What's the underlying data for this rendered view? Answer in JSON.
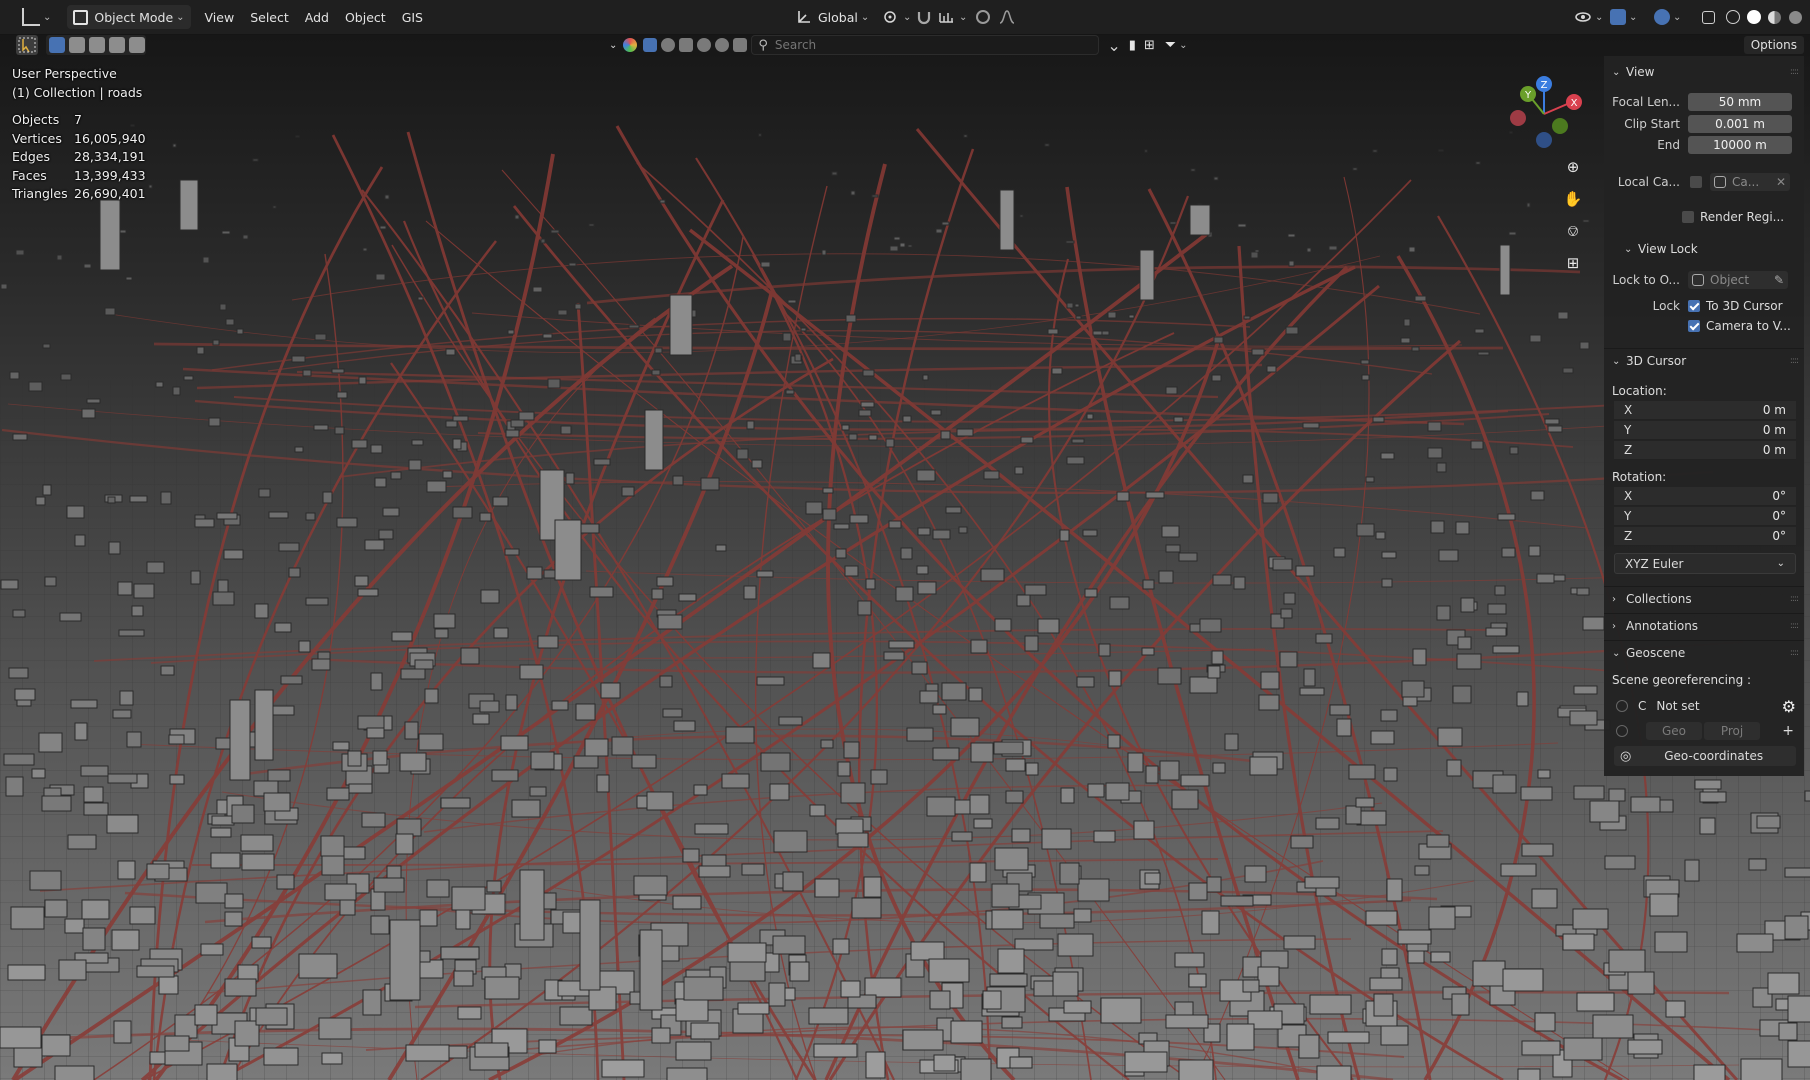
{
  "header": {
    "mode_label": "Object Mode",
    "menus": [
      "View",
      "Select",
      "Add",
      "Object",
      "GIS"
    ],
    "transform_orientation": "Global"
  },
  "toolbar": {
    "search_placeholder": "Search",
    "options_label": "Options"
  },
  "overlay": {
    "perspective": "User Perspective",
    "collection": "(1) Collection | roads",
    "stats": [
      {
        "label": "Objects",
        "value": "7"
      },
      {
        "label": "Vertices",
        "value": "16,005,940"
      },
      {
        "label": "Edges",
        "value": "28,334,191"
      },
      {
        "label": "Faces",
        "value": "13,399,433"
      },
      {
        "label": "Triangles",
        "value": "26,690,401"
      }
    ]
  },
  "gizmo": {
    "x": "X",
    "y": "Y",
    "z": "Z"
  },
  "panel": {
    "view": {
      "title": "View",
      "focal_label": "Focal Len...",
      "focal_value": "50 mm",
      "clip_start_label": "Clip Start",
      "clip_start_value": "0.001 m",
      "clip_end_label": "End",
      "clip_end_value": "10000 m",
      "local_camera_label": "Local Ca...",
      "local_camera_value": "Ca...",
      "render_region_label": "Render Regi..."
    },
    "view_lock": {
      "title": "View Lock",
      "lock_to_label": "Lock to O...",
      "lock_to_value": "Object",
      "lock_label": "Lock",
      "to_3d_cursor": "To 3D Cursor",
      "camera_to_view": "Camera to V..."
    },
    "cursor": {
      "title": "3D Cursor",
      "location_label": "Location:",
      "location": [
        {
          "axis": "X",
          "value": "0 m"
        },
        {
          "axis": "Y",
          "value": "0 m"
        },
        {
          "axis": "Z",
          "value": "0 m"
        }
      ],
      "rotation_label": "Rotation:",
      "rotation": [
        {
          "axis": "X",
          "value": "0°"
        },
        {
          "axis": "Y",
          "value": "0°"
        },
        {
          "axis": "Z",
          "value": "0°"
        }
      ],
      "rotation_mode": "XYZ Euler"
    },
    "collections_title": "Collections",
    "annotations_title": "Annotations",
    "geoscene": {
      "title": "Geoscene",
      "georef_label": "Scene georeferencing :",
      "crs_letter": "C",
      "crs_value": "Not set",
      "geo_label": "Geo",
      "proj_label": "Proj",
      "geocoords_label": "Geo-coordinates"
    }
  },
  "colors": {
    "road": "#8a3a35",
    "ground": "#6b6b6b",
    "axis_x": "#d9414f",
    "axis_y": "#6a9f2a",
    "axis_z": "#3b7de0"
  }
}
